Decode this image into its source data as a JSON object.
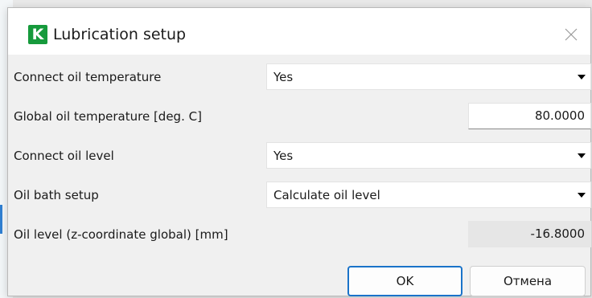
{
  "dialog": {
    "logo_letter": "K",
    "title": "Lubrication setup",
    "close_icon": "close-icon"
  },
  "fields": {
    "connect_oil_temperature": {
      "label": "Connect oil temperature",
      "value": "Yes"
    },
    "global_oil_temperature": {
      "label": "Global oil temperature [deg. C]",
      "value": "80.0000"
    },
    "connect_oil_level": {
      "label": "Connect oil level",
      "value": "Yes"
    },
    "oil_bath_setup": {
      "label": "Oil bath setup",
      "value": "Calculate oil level"
    },
    "oil_level": {
      "label": "Oil level (z-coordinate global) [mm]",
      "value": "-16.8000"
    }
  },
  "buttons": {
    "ok": "OK",
    "cancel": "Отмена"
  },
  "colors": {
    "logo_green": "#169a3c",
    "accent_blue": "#1a73c9",
    "dialog_bg": "#f0f0f0"
  }
}
